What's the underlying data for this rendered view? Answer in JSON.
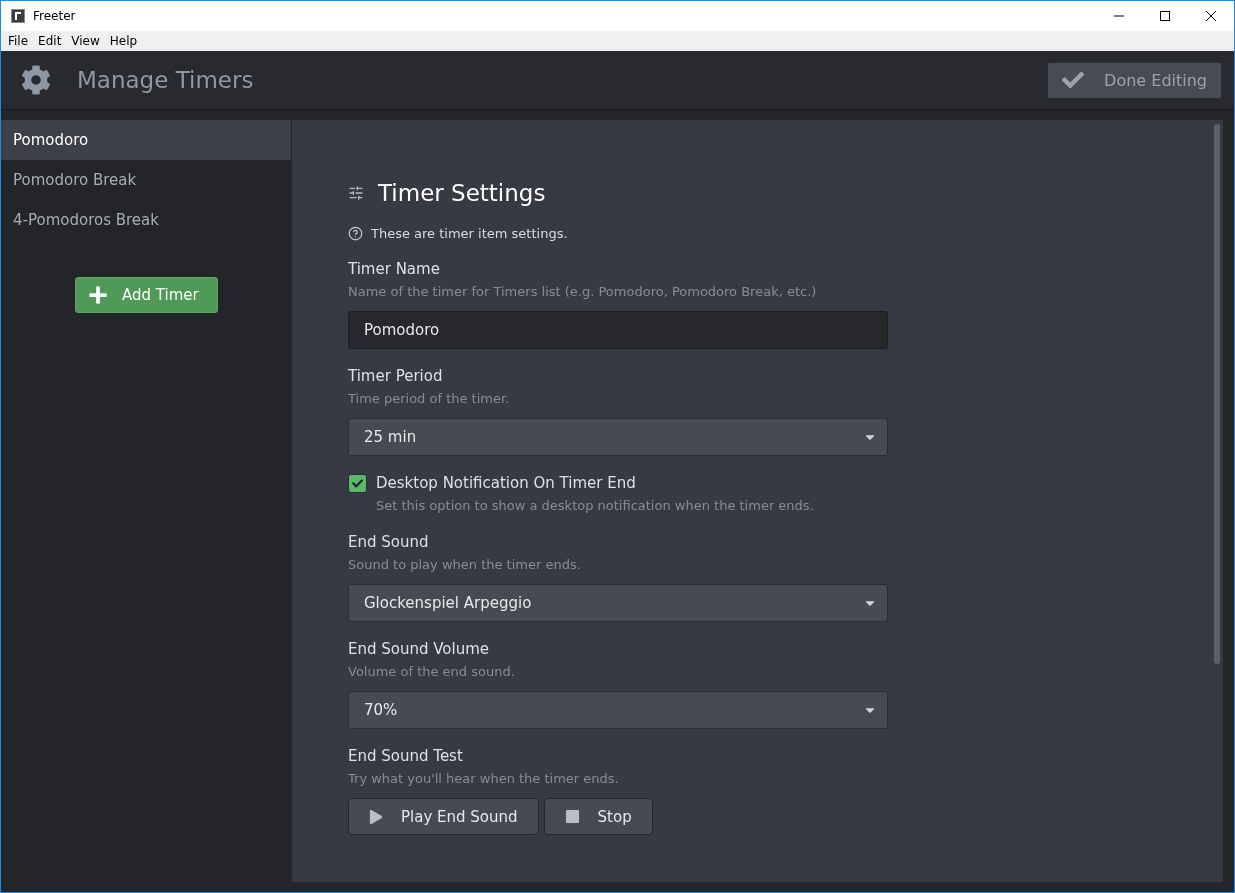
{
  "window": {
    "title": "Freeter"
  },
  "menu": [
    "File",
    "Edit",
    "View",
    "Help"
  ],
  "header": {
    "title": "Manage Timers",
    "done_button": "Done Editing"
  },
  "sidebar": {
    "items": [
      {
        "label": "Pomodoro",
        "selected": true
      },
      {
        "label": "Pomodoro Break",
        "selected": false
      },
      {
        "label": "4-Pomodoros Break",
        "selected": false
      }
    ],
    "add_button": "Add Timer"
  },
  "settings": {
    "title": "Timer Settings",
    "info": "These are timer item settings.",
    "fields": [
      {
        "kind": "text",
        "label": "Timer Name",
        "description": "Name of the timer for Timers list (e.g. Pomodoro, Pomodoro Break, etc.)",
        "value": "Pomodoro"
      },
      {
        "kind": "select",
        "label": "Timer Period",
        "description": "Time period of the timer.",
        "value": "25 min"
      },
      {
        "kind": "checkbox",
        "label": "Desktop Notification On Timer End",
        "description": "Set this option to show a desktop notification when the timer ends.",
        "checked": true
      },
      {
        "kind": "select",
        "label": "End Sound",
        "description": "Sound to play when the timer ends.",
        "value": "Glockenspiel Arpeggio"
      },
      {
        "kind": "select",
        "label": "End Sound Volume",
        "description": "Volume of the end sound.",
        "value": "70%"
      },
      {
        "kind": "buttons",
        "label": "End Sound Test",
        "description": "Try what you'll hear when the timer ends.",
        "buttons": [
          {
            "label": "Play End Sound"
          },
          {
            "label": "Stop"
          }
        ]
      }
    ]
  }
}
